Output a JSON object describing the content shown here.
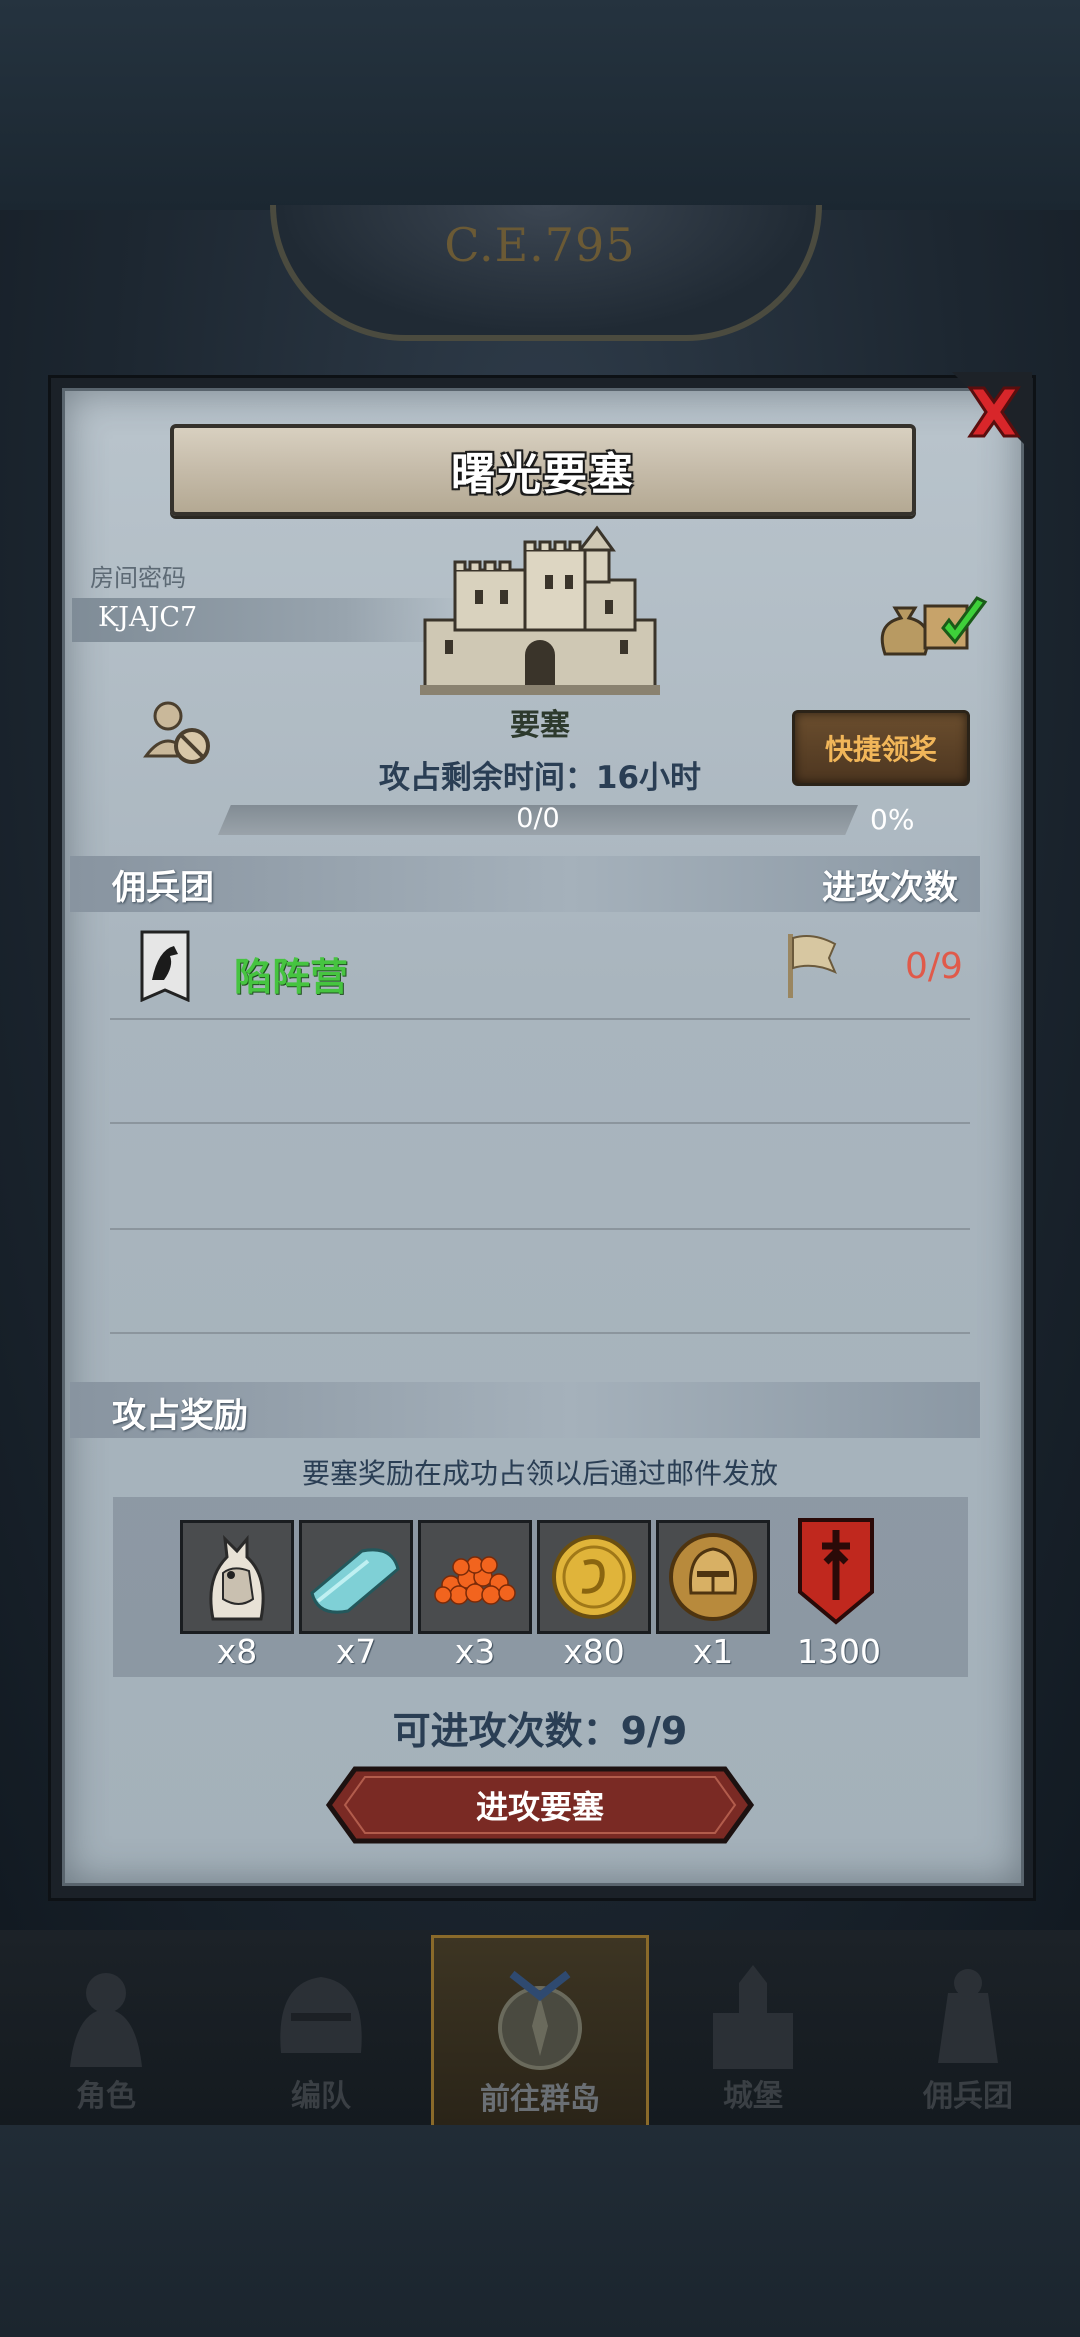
{
  "header": {
    "era_text": "C.E.795"
  },
  "dialog": {
    "title": "曙光要塞",
    "room_code_label": "房间密码",
    "room_code": "KJAJC7",
    "building_label": "要塞",
    "timer_text": "攻占剩余时间：16小时",
    "progress_text": "0/0",
    "progress_percent": "0%",
    "progress_fraction": 0,
    "quick_claim_label": "快捷领奖",
    "mercenary_header": "佣兵团",
    "attack_count_header": "进攻次数",
    "mercenaries": [
      {
        "name": "陷阵营",
        "attacks": "0/9"
      }
    ],
    "rewards_header": "攻占奖励",
    "rewards_note": "要塞奖励在成功占领以后通过邮件发放",
    "rewards": [
      {
        "icon": "horse-icon",
        "qty": "x8"
      },
      {
        "icon": "cloth-icon",
        "qty": "x7"
      },
      {
        "icon": "roe-icon",
        "qty": "x3"
      },
      {
        "icon": "gold-coin-icon",
        "qty": "x80"
      },
      {
        "icon": "helmet-medal-icon",
        "qty": "x1"
      },
      {
        "icon": "honor-banner-icon",
        "qty": "1300"
      }
    ],
    "attempts_text": "可进攻次数：9/9",
    "attack_button_label": "进攻要塞"
  },
  "bottom_nav": [
    {
      "label": "角色",
      "active": false
    },
    {
      "label": "编队",
      "active": false
    },
    {
      "label": "前往群岛",
      "active": true
    },
    {
      "label": "城堡",
      "active": false
    },
    {
      "label": "佣兵团",
      "active": false
    }
  ],
  "colors": {
    "accent_green": "#46c440",
    "attack_count_red": "#e05a4a",
    "quick_claim_text": "#f1b659",
    "attack_button": "#7a2a24"
  }
}
